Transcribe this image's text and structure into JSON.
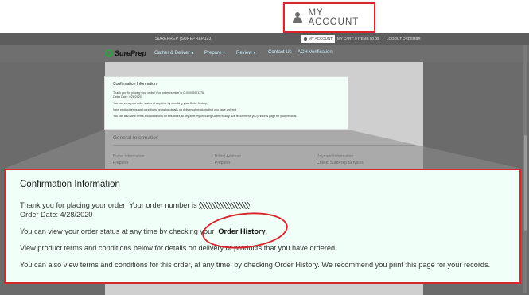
{
  "topbar": {
    "user": "SUREPREP (SUREPREP123)",
    "my_account": "MY ACCOUNT",
    "cart": "MY CART: 0 ITEMS $0.00",
    "logout": "LOGOUT ORDERBR"
  },
  "logo": {
    "text": "SurePrep"
  },
  "nav": {
    "items": [
      "Gather & Deliver ▾",
      "Prepare ▾",
      "Review ▾",
      "Contact Us",
      "ACH Verification"
    ]
  },
  "small_confirmation": {
    "title": "Confirmation Information",
    "line1": "Thank you for placing your order! Your order number is O-00000001376.",
    "line2": "Order Date: 4/28/2020",
    "line3": "You can view your order status at any time by checking your Order History.",
    "line4": "View product terms and conditions below for details on delivery of products that you have ordered.",
    "line5": "You can also view terms and conditions for this order, at any time, by checking Order History. We recommend you print this page for your records."
  },
  "general": {
    "title": "General Information",
    "buyer_label": "Buyer Information",
    "buyer_value": "Preparer",
    "billing_label": "Billing Address",
    "billing_value": "Preparer",
    "payment_label": "Payment Information",
    "payment_value": "Check: SurePrep Services"
  },
  "callout": {
    "title": "Confirmation Information",
    "thank_you": "Thank you for placing your order! Your order number is",
    "order_date": "Order Date: 4/28/2020",
    "status_prefix": "You can view your order status at any time by checking your",
    "order_history": "Order History",
    "status_suffix": ".",
    "terms": "View product terms and conditions below for details on delivery of products that you have ordered.",
    "also": "You can also view terms and conditions for this order, at any time, by checking Order History. We recommend you print this page for your records."
  },
  "account_callout": {
    "label": "MY ACCOUNT",
    "icon": "person-icon"
  },
  "colors": {
    "highlight_red": "#d9262c",
    "confirm_bg": "#f1fff9",
    "brand_green": "#2ea043"
  }
}
